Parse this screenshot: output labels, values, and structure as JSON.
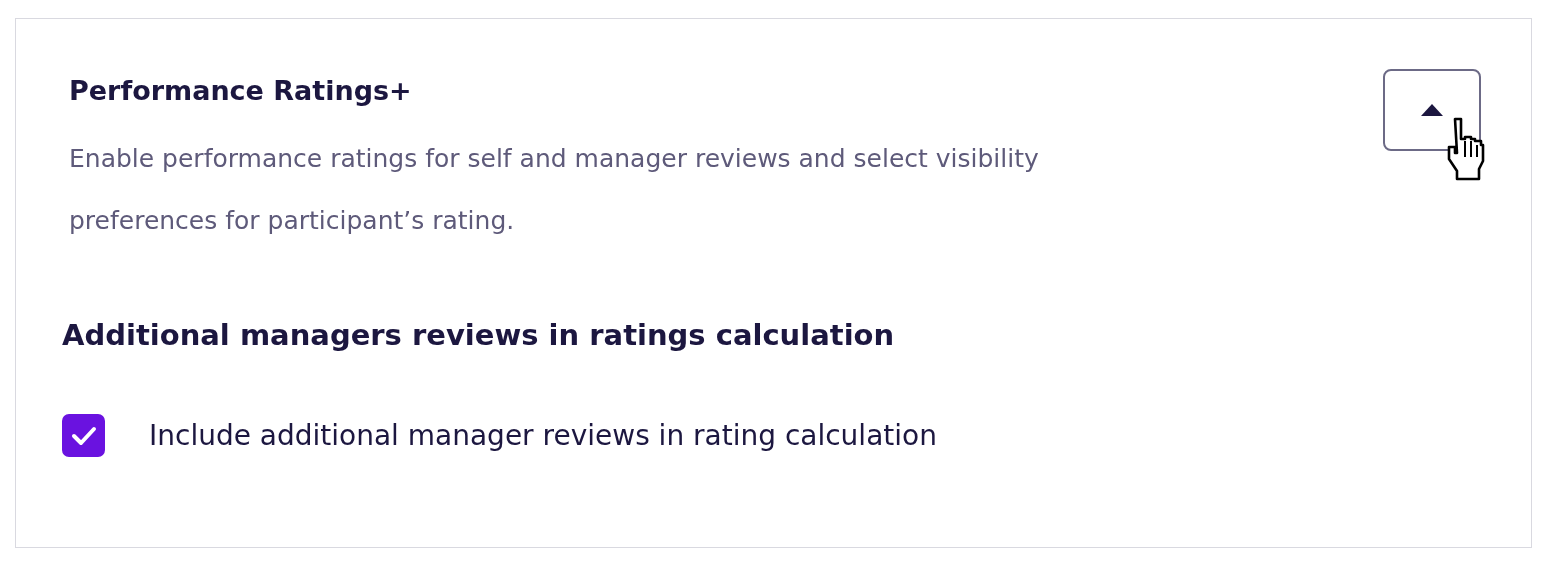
{
  "panel": {
    "title": "Performance Ratings+",
    "description": "Enable performance ratings for self and manager reviews and select visibility preferences for participant’s rating.",
    "expanded": true
  },
  "section": {
    "heading": "Additional managers reviews in ratings calculation"
  },
  "option": {
    "label": "Include additional manager reviews in rating calculation",
    "checked": true
  }
}
